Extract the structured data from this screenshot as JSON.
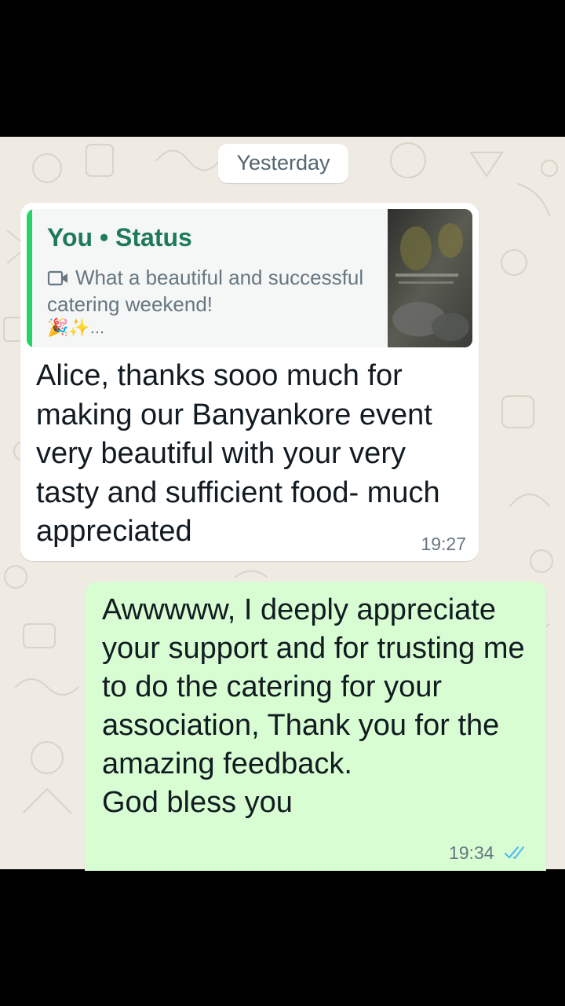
{
  "chat": {
    "date_separator": "Yesterday",
    "messages": [
      {
        "direction": "incoming",
        "reply": {
          "author": "You • Status",
          "media_icon": "video-icon",
          "text": "What a beautiful and successful catering weekend!",
          "emoji_line": "🎉✨..."
        },
        "text": "Alice, thanks sooo much for making our Banyankore event very beautiful with your very tasty and sufficient food- much appreciated",
        "time": "19:27"
      },
      {
        "direction": "outgoing",
        "text": "Awwwww, I deeply appreciate your support and for trusting me to do the catering for your association, Thank you for the amazing feedback.\nGod bless you",
        "time": "19:34",
        "status_icon": "double-check-read-icon"
      }
    ]
  },
  "colors": {
    "chat_background": "#efeae2",
    "incoming_bubble": "#ffffff",
    "outgoing_bubble": "#d9fdd3",
    "reply_accent": "#25d366",
    "reply_author": "#1f7a5a",
    "read_ticks": "#53bdeb"
  }
}
